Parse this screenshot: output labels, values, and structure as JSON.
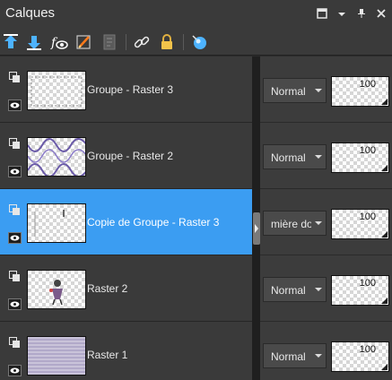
{
  "panel": {
    "title": "Calques"
  },
  "layers": [
    {
      "name": "Groupe - Raster 3",
      "blend": "Normal",
      "opacity": "100",
      "selected": false,
      "thumb": "frame"
    },
    {
      "name": "Groupe - Raster 2",
      "blend": "Normal",
      "opacity": "100",
      "selected": false,
      "thumb": "wave"
    },
    {
      "name": "Copie de Groupe - Raster 3",
      "blend": "mière dou",
      "opacity": "100",
      "selected": true,
      "thumb": "faint"
    },
    {
      "name": "Raster 2",
      "blend": "Normal",
      "opacity": "100",
      "selected": false,
      "thumb": "figure"
    },
    {
      "name": "Raster 1",
      "blend": "Normal",
      "opacity": "100",
      "selected": false,
      "thumb": "stripes"
    }
  ],
  "toolbar_icons": [
    "move-up-icon",
    "move-down-icon",
    "visibility-toggle-icon",
    "edit-icon",
    "mask-icon",
    "link-icon",
    "lock-icon",
    "properties-icon"
  ],
  "colors": {
    "selection": "#3b9df2",
    "panel_bg": "#3a3a3a",
    "accent_icon": "#4db3ff"
  }
}
